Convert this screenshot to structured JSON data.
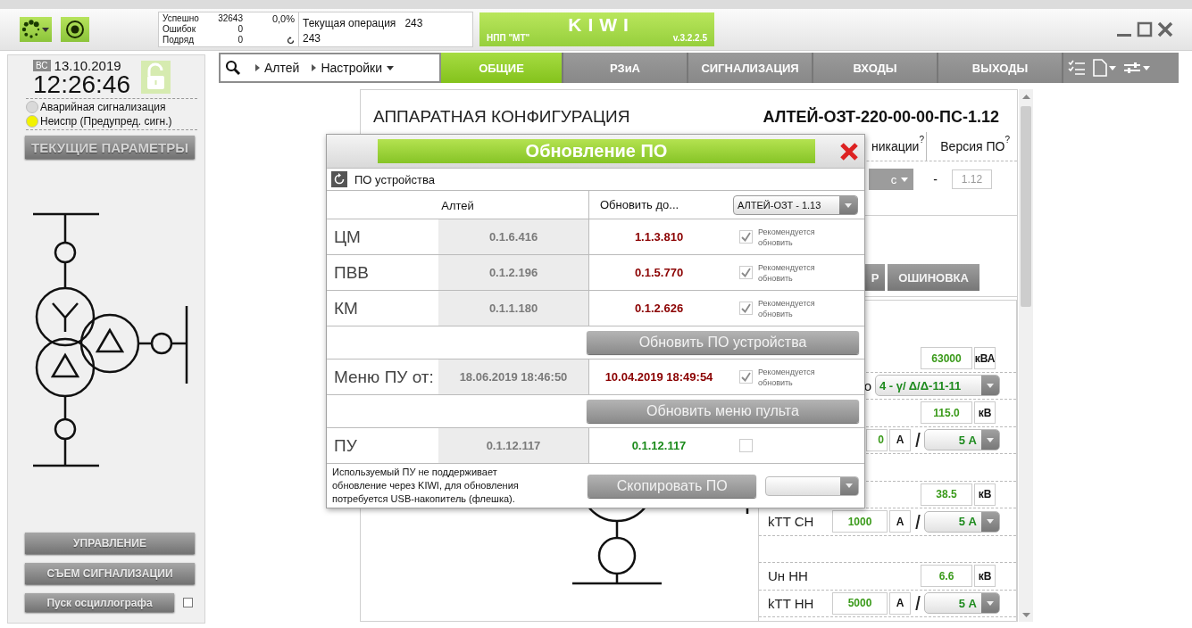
{
  "toolbar": {
    "stats": [
      {
        "label": "Успешно",
        "value": "32643"
      },
      {
        "label": "Ошибок",
        "value": "0"
      },
      {
        "label": "Подряд",
        "value": "0"
      }
    ],
    "percent": "0,0%",
    "operation_label": "Текущая операция",
    "operation_value": "243",
    "operation_total": "243"
  },
  "brand": {
    "company": "НПП \"МТ\"",
    "name": "KIWI",
    "version": "v.3.2.2.5"
  },
  "left_panel": {
    "weekday": "ВС",
    "date": "13.10.2019",
    "time": "12:26:46",
    "alarms": [
      {
        "label": "Аварийная сигнализация",
        "color": "#d9d9d9"
      },
      {
        "label": "Неиспр (Предупред. сигн.)",
        "color": "#f2f200"
      }
    ],
    "params_button": "ТЕКУЩИЕ ПАРАМЕТРЫ",
    "buttons": [
      "УПРАВЛЕНИЕ",
      "СЪЕМ СИГНАЛИЗАЦИИ"
    ],
    "oscillograph": {
      "label": "Пуск осциллографа",
      "checked": false
    }
  },
  "nav": {
    "breadcrumbs": [
      {
        "label": "Алтей",
        "dropdown": false
      },
      {
        "label": "Настройки",
        "dropdown": true
      }
    ],
    "tabs": [
      {
        "label": "ОБЩИЕ",
        "selected": true
      },
      {
        "label": "РЗиА",
        "selected": false
      },
      {
        "label": "СИГНАЛИЗАЦИЯ",
        "selected": false
      },
      {
        "label": "ВХОДЫ",
        "selected": false
      },
      {
        "label": "ВЫХОДЫ",
        "selected": false
      }
    ]
  },
  "config": {
    "title": "АППАРАТНАЯ КОНФИГУРАЦИЯ",
    "device": "АЛТЕЙ-ОЗТ-220-00-00-ПС-1.12",
    "columns": [
      {
        "label": "никации",
        "hint": "?"
      },
      {
        "label": "Версия ПО",
        "hint": "?"
      }
    ],
    "protocol": "с",
    "dash": "-",
    "version": "1.12",
    "buttons": [
      "Р",
      "ОШИНОВКА"
    ],
    "params": [
      {
        "kind": "value",
        "value": "63000",
        "unit": "кВА"
      },
      {
        "kind": "select",
        "fragment": "о",
        "value": "4 - γ/ Δ/Δ-11-11"
      },
      {
        "kind": "value",
        "value": "115.0",
        "unit": "кВ"
      },
      {
        "kind": "ratio",
        "value": "0",
        "unit": "А",
        "secondary": "5 А"
      },
      {
        "kind": "blank"
      },
      {
        "kind": "value",
        "value": "38.5",
        "unit": "кВ"
      },
      {
        "kind": "ratio",
        "label": "kTT СН",
        "value": "1000",
        "unit": "А",
        "secondary": "5 А"
      },
      {
        "kind": "blank"
      },
      {
        "kind": "value",
        "label": "Uн НН",
        "value": "6.6",
        "unit": "кВ"
      },
      {
        "kind": "ratio",
        "label": "kTT НН",
        "value": "5000",
        "unit": "А",
        "secondary": "5 А"
      }
    ]
  },
  "dialog": {
    "title": "Обновление ПО",
    "section": "ПО устройства",
    "device_header": "Алтей",
    "target_header": "Обновить до...",
    "target_select": "АЛТЕЙ-ОЗТ - 1.13",
    "rows": [
      {
        "kind": "module",
        "name": "ЦМ",
        "current": "0.1.6.416",
        "target": "1.1.3.810",
        "color": "#8b0000",
        "checked": true,
        "note": "Рекомендуется обновить"
      },
      {
        "kind": "module",
        "name": "ПВВ",
        "current": "0.1.2.196",
        "target": "0.1.5.770",
        "color": "#8b0000",
        "checked": true,
        "note": "Рекомендуется обновить"
      },
      {
        "kind": "module",
        "name": "КМ",
        "current": "0.1.1.180",
        "target": "0.1.2.626",
        "color": "#8b0000",
        "checked": true,
        "note": "Рекомендуется обновить"
      },
      {
        "kind": "action",
        "button": "Обновить ПО устройства"
      },
      {
        "kind": "module",
        "name": "Меню ПУ от:",
        "current": "18.06.2019 18:46:50",
        "target": "10.04.2019 18:49:54",
        "color": "#8b0000",
        "checked": true,
        "note": "Рекомендуется обновить"
      },
      {
        "kind": "action",
        "button": "Обновить меню пульта"
      },
      {
        "kind": "module",
        "name": "ПУ",
        "current": "0.1.12.117",
        "target": "0.1.12.117",
        "color": "#1a8a1a",
        "checked": false
      }
    ],
    "footer": {
      "note": "Используемый ПУ не поддерживает обновление через KIWI, для обновления потребуется USB-накопитель (флешка).",
      "button": "Скопировать ПО"
    }
  }
}
